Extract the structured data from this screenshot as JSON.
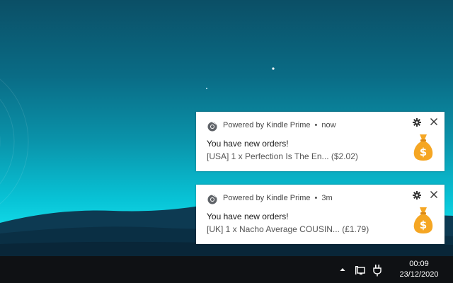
{
  "notifications": [
    {
      "app_name": "Powered by Kindle Prime",
      "separator": "•",
      "time": "now",
      "title": "You have new orders!",
      "body": "[USA] 1 x Perfection Is The En... ($2.02)",
      "app_icon": "chrome-icon",
      "image_icon": "money-bag-icon"
    },
    {
      "app_name": "Powered by Kindle Prime",
      "separator": "•",
      "time": "3m",
      "title": "You have new orders!",
      "body": "[UK] 1 x Nacho Average COUSIN... (£1.79)",
      "app_icon": "chrome-icon",
      "image_icon": "money-bag-icon"
    }
  ],
  "taskbar": {
    "clock_time": "00:09",
    "clock_date": "23/12/2020"
  },
  "colors": {
    "money_bag": "#f5a623",
    "taskbar": "#0f1114",
    "desktop_top": "#0b4f66",
    "desktop_glow": "#11d8e6"
  }
}
